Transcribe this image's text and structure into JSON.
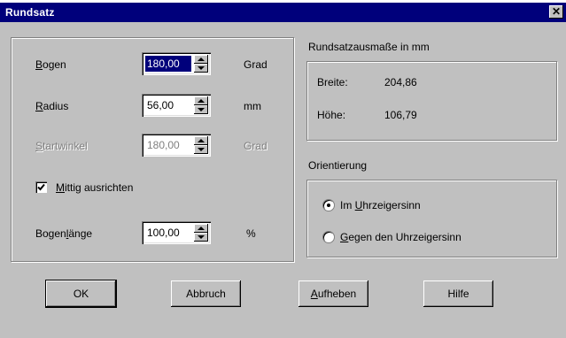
{
  "window": {
    "title": "Rundsatz",
    "close_glyph": "✕"
  },
  "params": {
    "bogen": {
      "label_u": "B",
      "label_rest": "ogen",
      "value": "180,00",
      "unit": "Grad"
    },
    "radius": {
      "label_u": "R",
      "label_rest": "adius",
      "value": "56,00",
      "unit": "mm"
    },
    "startwinkel": {
      "label_u": "S",
      "label_rest": "tartwinkel",
      "value": "180,00",
      "unit": "Grad"
    },
    "mittig": {
      "label_u": "M",
      "label_rest": "ittig ausrichten",
      "checked": true
    },
    "bogenlaenge": {
      "label_pre": "Bogen",
      "label_u": "l",
      "label_rest": "änge",
      "value": "100,00",
      "unit": "%"
    }
  },
  "dimensions": {
    "title": "Rundsatzausmaße in mm",
    "breite_label": "Breite:",
    "breite_value": "204,86",
    "hoehe_label": "Höhe:",
    "hoehe_value": "106,79"
  },
  "orientation": {
    "title": "Orientierung",
    "option1_pre": "Im ",
    "option1_u": "U",
    "option1_rest": "hrzeigersinn",
    "option2_u": "G",
    "option2_rest": "egen den Uhrzeigersinn",
    "selected": 1
  },
  "buttons": {
    "ok": "OK",
    "abbruch": "Abbruch",
    "aufheben_u": "A",
    "aufheben_rest": "ufheben",
    "hilfe": "Hilfe"
  }
}
